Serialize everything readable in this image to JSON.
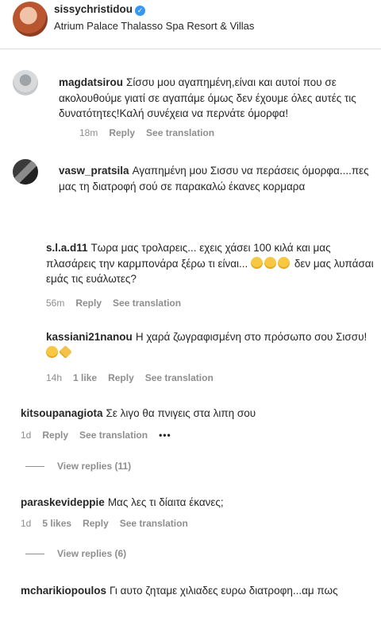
{
  "header": {
    "username": "sissychristidou",
    "location": "Atrium Palace Thalasso Spa Resort & Villas"
  },
  "comments": [
    {
      "username": "magdatsirou",
      "text": "Σίσσυ μου αγαπημένη,είναι και αυτοί που σε ακολουθούμε γιατί σε αγαπάμε όμως δεν έχουμε όλες αυτές τις δυνατότητες!Καλή συνέχεια να περνάτε όμορφα!",
      "time": "18m",
      "reply": "Reply",
      "see_translation": "See translation"
    },
    {
      "username": "vasw_pratsila",
      "text": "Αγαπημένη μου Σισσυ να περάσεις όμορφα....πες μας τη διατροφή σού σε παρακαλώ έκανες κορμαρα"
    },
    {
      "username": "s.l.a.d11",
      "text": "Τωρα μας τρολαρεις... εχεις χάσει 100 κιλά και μας πλασάρεις την καρμπονάρα ξέρω τι είναι...",
      "text2": "δεν μας λυπάσαι εμάς τις ευάλωτες?",
      "time": "56m",
      "reply": "Reply",
      "see_translation": "See translation"
    },
    {
      "username": "kassiani21nanou",
      "text": "Η χαρά ζωγραφισμένη στο πρόσωπο σου Σισσυ!",
      "time": "14h",
      "likes": "1 like",
      "reply": "Reply",
      "see_translation": "See translation"
    },
    {
      "username": "kitsoupanagiota",
      "text": "Σε λιγο θα πνιγεις στα λιπη σου",
      "time": "1d",
      "reply": "Reply",
      "see_translation": "See translation",
      "more": "•••",
      "view_replies": "View replies (11)"
    },
    {
      "username": "paraskevideppie",
      "text": "Μας λες τι δίαιτα έκανες;",
      "time": "1d",
      "likes": "5 likes",
      "reply": "Reply",
      "see_translation": "See translation",
      "view_replies": "View replies (6)"
    },
    {
      "username": "mcharikiopoulos",
      "text": "Γι αυτο ζηταμε χιλιαδες ευρω διατροφη...αμ πως"
    }
  ]
}
